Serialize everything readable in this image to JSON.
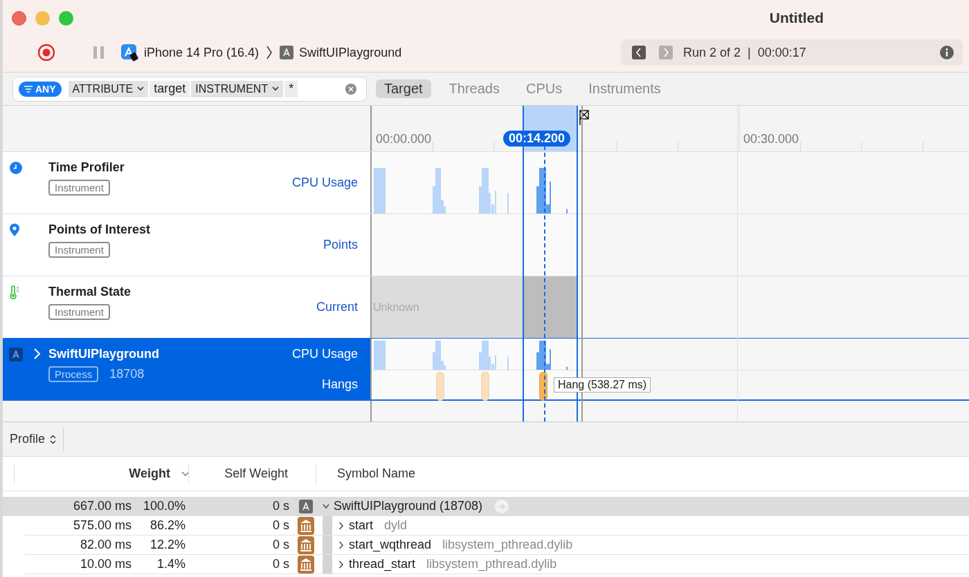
{
  "window": {
    "title": "Untitled"
  },
  "toolbar": {
    "device": "iPhone 14 Pro (16.4)",
    "target": "SwiftUIPlayground",
    "run": "Run 2 of 2",
    "run_separator": "|",
    "elapsed": "00:00:17",
    "run_nav": [
      {
        "kind": "prev",
        "disabled": false
      },
      {
        "kind": "next",
        "disabled": true
      }
    ]
  },
  "filter": {
    "scope": "ANY",
    "tokens": [
      {
        "kind": "menu",
        "text": "ATTRIBUTE"
      },
      {
        "kind": "value",
        "text": "target"
      },
      {
        "kind": "menu",
        "text": "INSTRUMENT"
      },
      {
        "kind": "value",
        "text": "*"
      }
    ]
  },
  "tabs": [
    {
      "label": "Target",
      "selected": true
    },
    {
      "label": "Threads",
      "selected": false
    },
    {
      "label": "CPUs",
      "selected": false
    },
    {
      "label": "Instruments",
      "selected": false
    }
  ],
  "timeline": {
    "ruler_labels": [
      "00:00.000",
      "00:30.000"
    ],
    "playhead": "00:14.200",
    "tracks": [
      {
        "kind": "instrument",
        "name": "Time Profiler",
        "badge": "Instrument",
        "selected": false,
        "lanes": [
          {
            "kind": "cpu",
            "label": "CPU Usage"
          }
        ]
      },
      {
        "kind": "instrument",
        "name": "Points of Interest",
        "badge": "Instrument",
        "selected": false,
        "lanes": [
          {
            "kind": "points",
            "label": "Points"
          }
        ]
      },
      {
        "kind": "instrument",
        "name": "Thermal State",
        "badge": "Instrument",
        "selected": false,
        "lanes": [
          {
            "kind": "state",
            "label": "Current",
            "state": "Unknown"
          }
        ]
      },
      {
        "kind": "process",
        "name": "SwiftUIPlayground",
        "badge": "Process",
        "pid": "18708",
        "selected": true,
        "expanded": false,
        "lanes": [
          {
            "kind": "cpu",
            "label": "CPU Usage"
          },
          {
            "kind": "hangs",
            "label": "Hangs",
            "tooltip": "Hang (538.27 ms)"
          }
        ]
      }
    ]
  },
  "profile": {
    "view": "Profile",
    "columns": [
      {
        "label": "Weight",
        "sorted": true
      },
      {
        "label": "Self Weight",
        "sorted": false
      },
      {
        "label": "Symbol Name",
        "sorted": false
      }
    ],
    "rows": [
      {
        "kind": "process",
        "weight": "667.00 ms",
        "percent": "100.0%",
        "self": "0 s",
        "symbol": "SwiftUIPlayground (18708)",
        "selected": true,
        "expanded": true,
        "children": [
          {
            "kind": "library",
            "weight": "575.00 ms",
            "percent": "86.2%",
            "self": "0 s",
            "symbol": "start",
            "library": "dyld",
            "selected": false,
            "expanded": false
          },
          {
            "kind": "library",
            "weight": "82.00 ms",
            "percent": "12.2%",
            "self": "0 s",
            "symbol": "start_wqthread",
            "library": "libsystem_pthread.dylib",
            "selected": false,
            "expanded": false
          },
          {
            "kind": "library",
            "weight": "10.00 ms",
            "percent": "1.4%",
            "self": "0 s",
            "symbol": "thread_start",
            "library": "libsystem_pthread.dylib",
            "selected": false,
            "expanded": false
          }
        ]
      }
    ]
  }
}
